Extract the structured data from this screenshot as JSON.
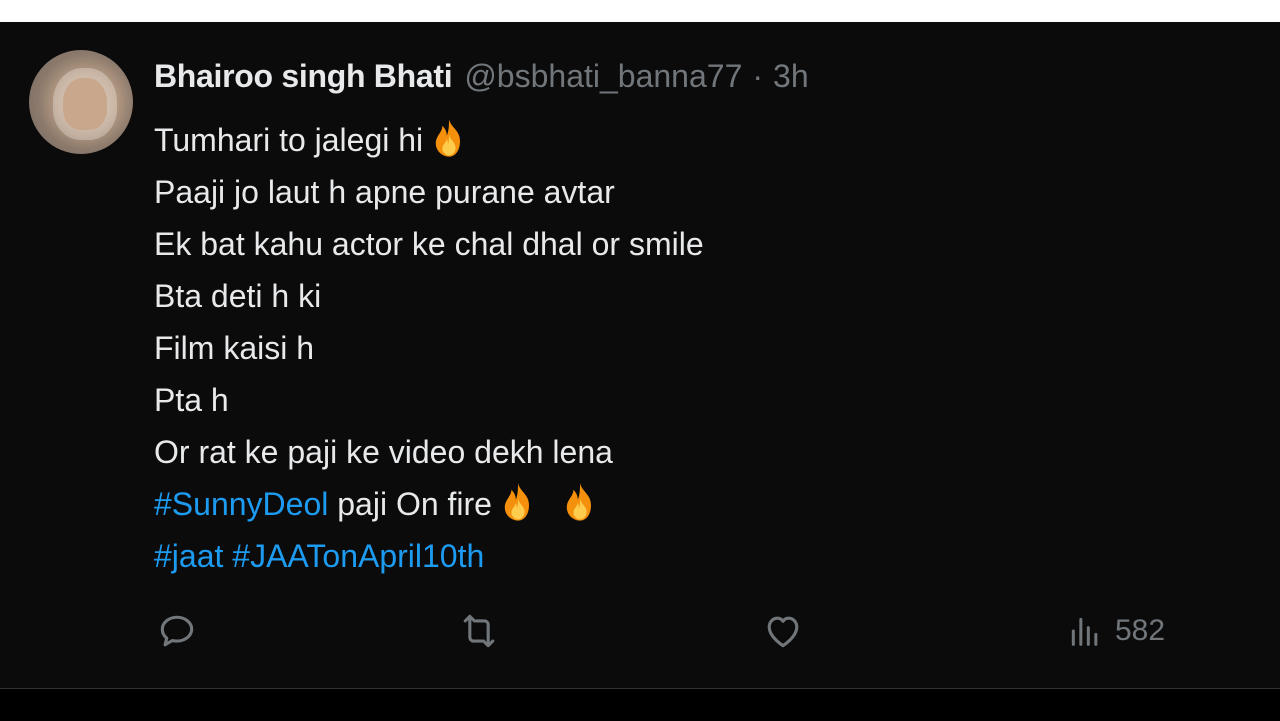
{
  "tweet": {
    "author": {
      "display_name": "Bhairoo singh Bhati",
      "handle": "@bsbhati_banna77",
      "separator": "·",
      "time": "3h"
    },
    "lines": [
      "Tumhari to jalegi hi",
      "Paaji jo laut h apne purane avtar",
      "Ek bat kahu actor ke chal dhal or smile",
      "Bta deti h ki",
      "Film kaisi h",
      "Pta h",
      "Or rat ke paji ke video dekh lena"
    ],
    "line8": {
      "hashtag": "#SunnyDeol",
      "text": " paji On fire"
    },
    "line9": {
      "hashtag1": "#jaat",
      "hashtag2": "#JAATonApril10th"
    },
    "actions": {
      "reply_icon": "reply-icon",
      "retweet_icon": "retweet-icon",
      "like_icon": "heart-icon",
      "views_icon": "analytics-icon",
      "views_count": "582"
    }
  },
  "colors": {
    "background": "#000000",
    "text": "#e7e9ea",
    "muted": "#71767b",
    "link": "#1d9bf0"
  }
}
